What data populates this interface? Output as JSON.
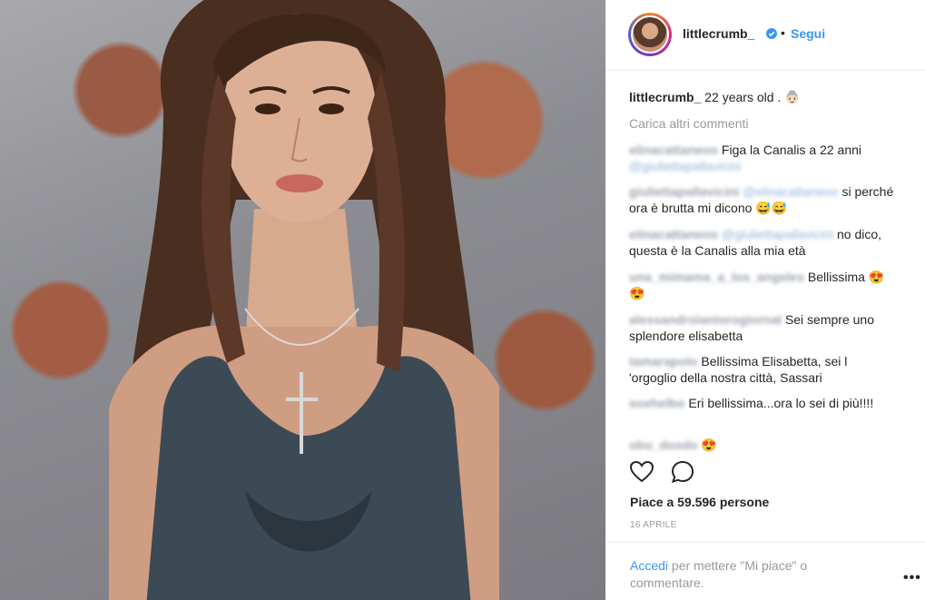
{
  "post": {
    "username": "littlecrumb_",
    "dot": "•",
    "follow_label": "Segui",
    "caption_user": "littlecrumb_",
    "caption_text": " 22 years old . 👵🏻",
    "load_more": "Carica altri commenti",
    "comments": [
      {
        "user": "elinacattaneoo",
        "text": "Figa la Canalis a 22 anni",
        "mention": "@giuliettapallavicini"
      },
      {
        "user": "giuliettapallavicini",
        "mention": "@elinacattaneoo",
        "text": " si perché ora è brutta mi dicono 😅😅"
      },
      {
        "user": "elinacattaneoo",
        "mention": "@giuliettapallavicini",
        "text": " no dico, questa è la Canalis alla mia età"
      },
      {
        "user": "una_mimama_a_los_angeles",
        "text": "Bellissima 😍😍"
      },
      {
        "user": "alessandroiantorogiornal",
        "text": "Sei sempre uno splendore elisabetta"
      },
      {
        "user": "tamarapolo",
        "text": "Bellissima Elisabetta, sei l 'orgoglio della nostra città, Sassari"
      },
      {
        "user": "soehelbo",
        "text": "Eri bellissima...ora lo sei di più!!!!"
      },
      {
        "user": "obu_dosdo",
        "text": "😍"
      }
    ],
    "likes": "Piace a 59.596 persone",
    "date": "16 APRILE",
    "login_link": "Accedi",
    "login_text": " per mettere \"Mi piace\" o commentare.",
    "more_options": "•••"
  },
  "icons": {
    "heart": "heart-icon",
    "comment": "comment-icon",
    "verified": "verified-badge-icon"
  },
  "colors": {
    "link": "#3897f0",
    "muted": "#999999",
    "text": "#262626"
  }
}
